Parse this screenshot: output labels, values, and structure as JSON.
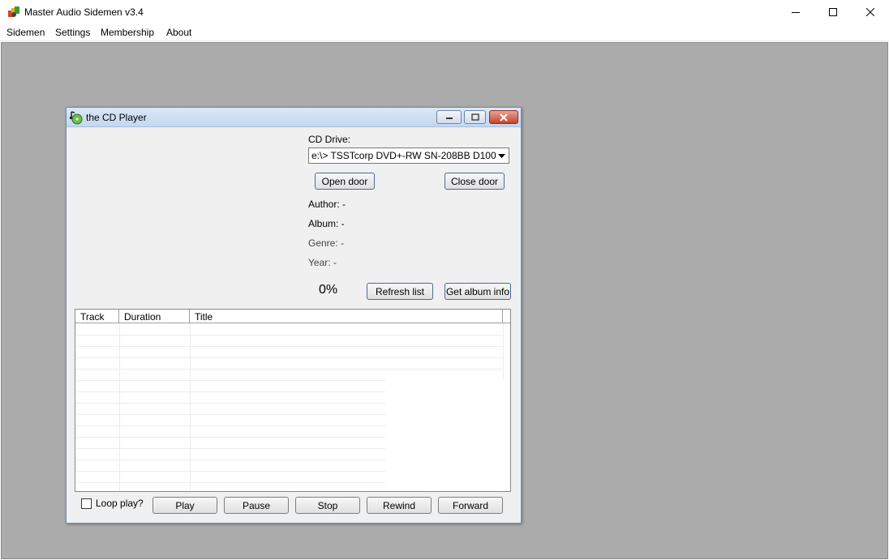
{
  "app": {
    "title": "Master Audio Sidemen v3.4"
  },
  "menu": [
    "Sidemen",
    "Settings",
    "Membership",
    "About"
  ],
  "child_window": {
    "title": "the CD Player",
    "cd_drive_label": "CD Drive:",
    "cd_drive_value": "e:\\> TSSTcorp DVD+-RW SN-208BB D100",
    "open_door": "Open door",
    "close_door": "Close door",
    "author": "Author: -",
    "album": "Album: -",
    "genre": "Genre: -",
    "year": "Year: -",
    "progress_text": "0%",
    "refresh_list": "Refresh list",
    "get_album_info": "Get album info",
    "columns": [
      "Track",
      "Duration",
      "Title"
    ],
    "loop_play": "Loop play?",
    "controls": [
      "Play",
      "Pause",
      "Stop",
      "Rewind",
      "Forward"
    ]
  }
}
